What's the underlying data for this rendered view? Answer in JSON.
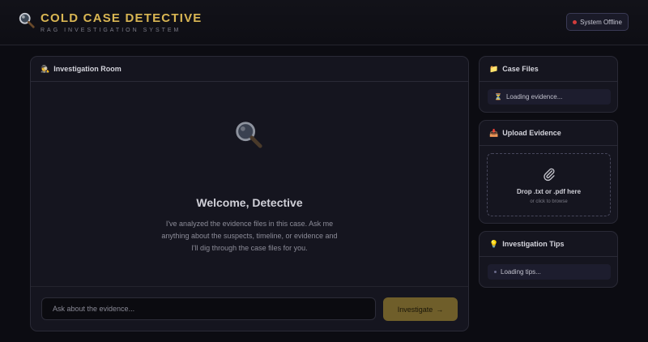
{
  "header": {
    "title": "COLD CASE DETECTIVE",
    "subtitle": "RAG INVESTIGATION SYSTEM",
    "logo_icon": "magnifying-glass",
    "status": {
      "label": "System Offline",
      "color": "#d23c3c"
    }
  },
  "chat": {
    "title": "Investigation Room",
    "title_icon": "detective-emoji",
    "welcome_title": "Welcome, Detective",
    "welcome_text": "I've analyzed the evidence files in this case. Ask me anything about the suspects, timeline, or evidence and I'll dig through the case files for you.",
    "input_placeholder": "Ask about the evidence...",
    "input_value": "",
    "submit_label": "Investigate",
    "submit_arrow": "→"
  },
  "case_files": {
    "title": "Case Files",
    "title_icon": "folder-emoji",
    "status_text": "Loading evidence...",
    "status_icon": "hourglass"
  },
  "upload": {
    "title": "Upload Evidence",
    "title_icon": "inbox-emoji",
    "drop_text": "Drop .txt or .pdf here",
    "drop_subtext": "or click to browse",
    "drop_icon": "paperclip"
  },
  "tips": {
    "title": "Investigation Tips",
    "title_icon": "lightbulb-emoji",
    "status_text": "Loading tips..."
  },
  "colors": {
    "accent_gold": "#d9b653",
    "button_gold": "#6f5e2a",
    "background": "#0c0c12",
    "panel": "#15151f"
  }
}
